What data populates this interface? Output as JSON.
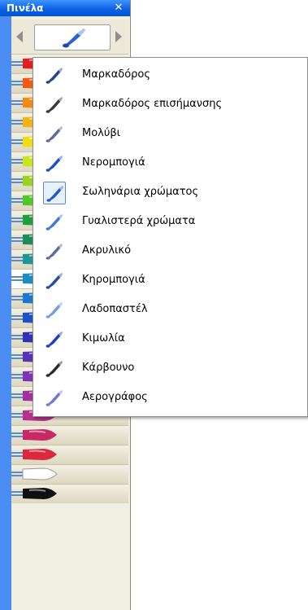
{
  "panel": {
    "title": "Πινέλα",
    "close_icon": "close-icon",
    "prev_icon": "arrow-left-icon",
    "next_icon": "arrow-right-icon",
    "current_brush_icon": "watercolor-brush-icon",
    "accent_color": "#0a5ee0"
  },
  "swatches": [
    {
      "color": "#e02020"
    },
    {
      "color": "#f05a14"
    },
    {
      "color": "#f08c14"
    },
    {
      "color": "#f0b414"
    },
    {
      "color": "#f0dc14"
    },
    {
      "color": "#c8e61e"
    },
    {
      "color": "#9ad21e"
    },
    {
      "color": "#50c828"
    },
    {
      "color": "#1ea03c"
    },
    {
      "color": "#1e8c5a"
    },
    {
      "color": "#1e9696"
    },
    {
      "color": "#1e8cbe"
    },
    {
      "color": "#1e78d2"
    },
    {
      "color": "#1e50c8"
    },
    {
      "color": "#3232b4"
    },
    {
      "color": "#5a32b4"
    },
    {
      "color": "#8232b4"
    },
    {
      "color": "#a032a0"
    },
    {
      "color": "#b4328c"
    },
    {
      "color": "#c82864"
    },
    {
      "color": "#dc283c"
    },
    {
      "color": "#ffffff"
    },
    {
      "color": "#101010"
    }
  ],
  "selected_swatch_index": 11,
  "menu": {
    "items": [
      {
        "label": "Μαρκαδόρος",
        "icon": "marker-icon",
        "color": "#2a3f8f"
      },
      {
        "label": "Μαρκαδόρος επισήμανσης",
        "icon": "highlighter-icon",
        "color": "#3a3a3a"
      },
      {
        "label": "Μολύβι",
        "icon": "pencil-icon",
        "color": "#5a6c9a"
      },
      {
        "label": "Νερομπογιά",
        "icon": "watercolor-icon",
        "color": "#1e4ec8"
      },
      {
        "label": "Σωληνάρια χρώματος",
        "icon": "paint-tube-icon",
        "color": "#1e5ad2",
        "checked": true
      },
      {
        "label": "Γυαλιστερά χρώματα",
        "icon": "glossy-paint-icon",
        "color": "#3e7ad8"
      },
      {
        "label": "Ακρυλικό",
        "icon": "acrylic-icon",
        "color": "#5a6ea0"
      },
      {
        "label": "Κηρομπογιά",
        "icon": "crayon-icon",
        "color": "#2a4aa8"
      },
      {
        "label": "Λαδοπαστέλ",
        "icon": "oil-pastel-icon",
        "color": "#6fa0e0"
      },
      {
        "label": "Κιμωλία",
        "icon": "chalk-icon",
        "color": "#1e3cc8"
      },
      {
        "label": "Κάρβουνο",
        "icon": "charcoal-icon",
        "color": "#2a2a2a"
      },
      {
        "label": "Αερογράφος",
        "icon": "airbrush-icon",
        "color": "#6c7ad0"
      }
    ]
  }
}
